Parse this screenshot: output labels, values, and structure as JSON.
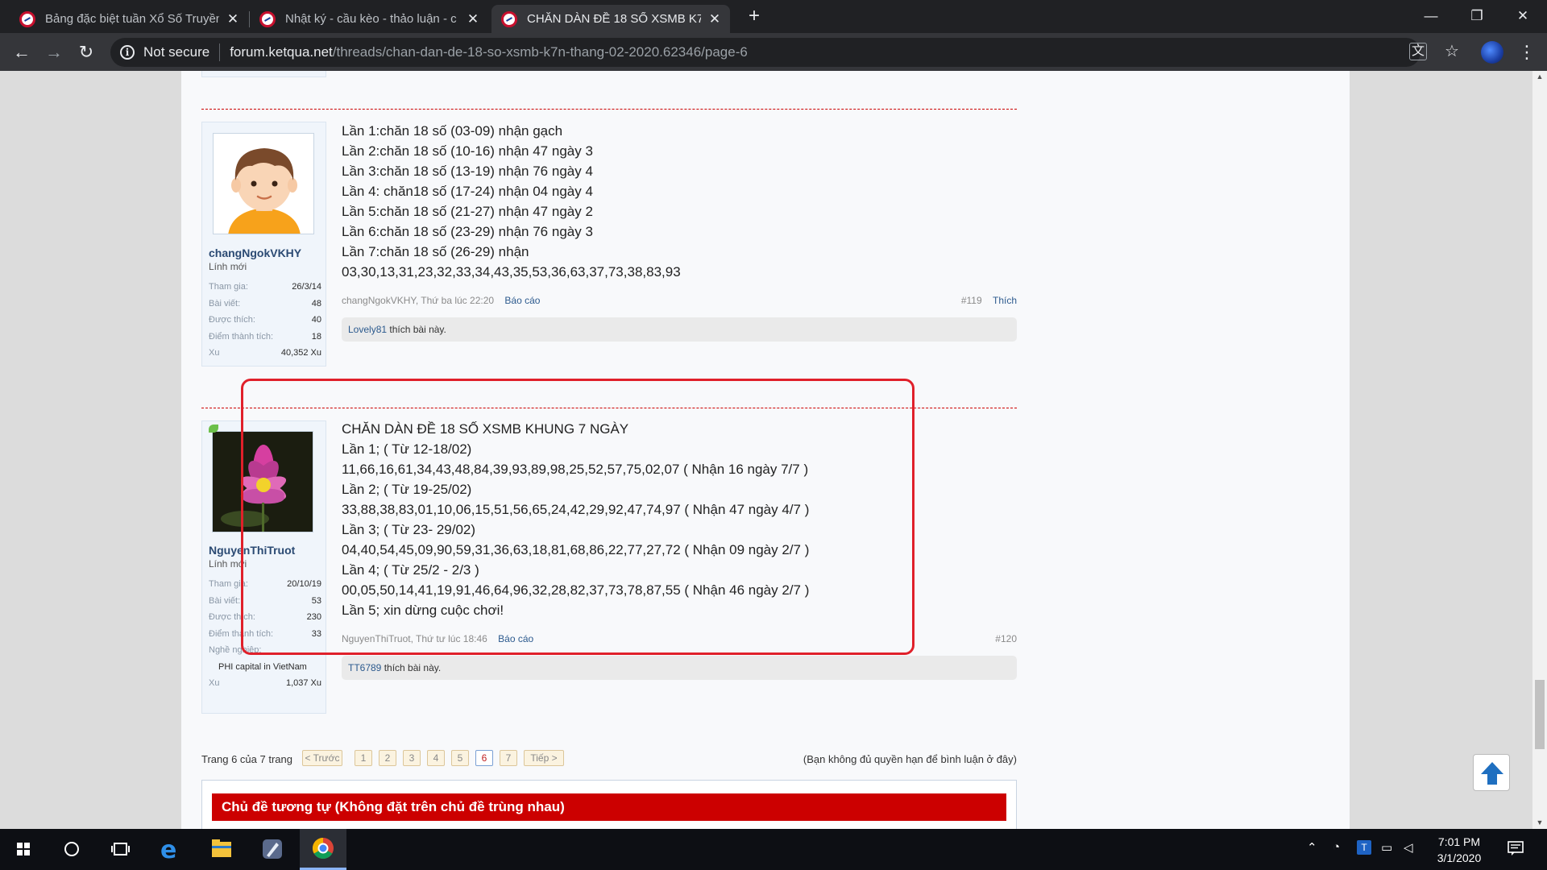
{
  "browser": {
    "tabs": [
      {
        "title": "Bảng đặc biệt tuần Xổ Số Truyền",
        "close": "✕"
      },
      {
        "title": "Nhật ký - cầu kèo - thảo luận - c",
        "close": "✕"
      },
      {
        "title": "CHĂN DÀN ĐỀ 18 SỐ XSMB K7N",
        "close": "✕"
      }
    ],
    "new_tab": "+",
    "window_controls": {
      "minimize": "—",
      "maximize": "❐",
      "close": "✕"
    },
    "nav": {
      "back": "←",
      "forward": "→",
      "reload": "↻"
    },
    "address": {
      "security": "Not secure",
      "host": "forum.ketqua.net",
      "path": "/threads/chan-dan-de-18-so-xsmb-k7n-thang-02-2020.62346/page-6"
    },
    "icons": {
      "translate": "translate-icon",
      "bookmark": "star-icon",
      "profile": "profile-avatar",
      "menu": "menu-icon"
    },
    "menu_glyph": "⋮",
    "star_glyph": "☆",
    "translate_glyph": "文"
  },
  "posts": [
    {
      "user": {
        "name": "changNgokVKHY",
        "title": "Lính mới",
        "stats": [
          {
            "label": "Tham gia:",
            "value": "26/3/14"
          },
          {
            "label": "Bài viết:",
            "value": "48"
          },
          {
            "label": "Được thích:",
            "value": "40"
          },
          {
            "label": "Điểm thành tích:",
            "value": "18"
          },
          {
            "label": "Xu",
            "value": "40,352 Xu"
          }
        ]
      },
      "lines": [
        "Lần 1:chăn 18 số (03-09) nhận gạch",
        "Lần 2:chăn 18 số (10-16) nhận 47 ngày 3",
        "Lần 3:chăn 18 số (13-19) nhận 76 ngày 4",
        "Lần 4: chăn18 số (17-24) nhận 04 ngày 4",
        "Lần 5:chăn 18 số (21-27) nhận 47 ngày 2",
        "Lần 6:chăn 18 số (23-29) nhận 76 ngày 3",
        "Lần 7:chăn 18 số (26-29) nhận",
        "03,30,13,31,23,32,33,34,43,35,53,36,63,37,73,38,83,93"
      ],
      "meta": {
        "author_time": "changNgokVKHY, Thứ ba lúc 22:20",
        "report": "Báo cáo",
        "number": "#119",
        "like": "Thích"
      },
      "likes": {
        "user": "Lovely81",
        "text": " thích bài này."
      }
    },
    {
      "user": {
        "name": "NguyenThiTruot",
        "title": "Lính mới",
        "stats": [
          {
            "label": "Tham gia:",
            "value": "20/10/19"
          },
          {
            "label": "Bài viết:",
            "value": "53"
          },
          {
            "label": "Được thích:",
            "value": "230"
          },
          {
            "label": "Điểm thành tích:",
            "value": "33"
          },
          {
            "label": "Nghề nghiệp:",
            "value": ""
          },
          {
            "label": "",
            "value": "PHI capital in VietNam"
          },
          {
            "label": "Xu",
            "value": "1,037 Xu"
          }
        ]
      },
      "lines": [
        "CHĂN DÀN ĐỀ 18 SỐ XSMB KHUNG 7 NGÀY",
        "Lần 1; ( Từ 12-18/02)",
        "11,66,16,61,34,43,48,84,39,93,89,98,25,52,57,75,02,07 ( Nhận 16 ngày 7/7 )",
        "Lần 2; ( Từ 19-25/02)",
        "33,88,38,83,01,10,06,15,51,56,65,24,42,29,92,47,74,97 ( Nhận 47 ngày 4/7 )",
        "Lần 3; ( Từ 23- 29/02)",
        "04,40,54,45,09,90,59,31,36,63,18,81,68,86,22,77,27,72 ( Nhận 09 ngày 2/7 )",
        "Lần 4; ( Từ 25/2 - 2/3 )",
        "00,05,50,14,41,19,91,46,64,96,32,28,82,37,73,78,87,55 ( Nhận 46 ngày 2/7 )",
        "Lần 5; xin dừng cuộc chơi!"
      ],
      "meta": {
        "author_time": "NguyenThiTruot, Thứ tư lúc 18:46",
        "report": "Báo cáo",
        "number": "#120"
      },
      "likes": {
        "user": "TT6789",
        "text": " thích bài này."
      }
    }
  ],
  "pagination": {
    "label": "Trang 6 của 7 trang",
    "prev": "< Trước",
    "pages": [
      "1",
      "2",
      "3",
      "4",
      "5",
      "6",
      "7"
    ],
    "current": "6",
    "next": "Tiếp >",
    "note": "(Bạn không đủ quyền hạn để bình luận ở đây)"
  },
  "similar": {
    "title": "Chủ đề tương tự (Không đặt trên chủ đề trùng nhau)"
  },
  "back_to_top": "up-arrow-icon",
  "taskbar": {
    "items": [
      "windows-start-icon",
      "search-circle-icon",
      "task-view-icon",
      "edge-icon",
      "file-explorer-icon",
      "app-icon",
      "chrome-icon"
    ],
    "clock": {
      "time": "7:01 PM",
      "date": "3/1/2020"
    }
  },
  "colors": {
    "accent_red": "#cc0000",
    "highlight_red": "#e0202a",
    "link_blue": "#2c5a8e",
    "chrome_dark": "#202124"
  }
}
